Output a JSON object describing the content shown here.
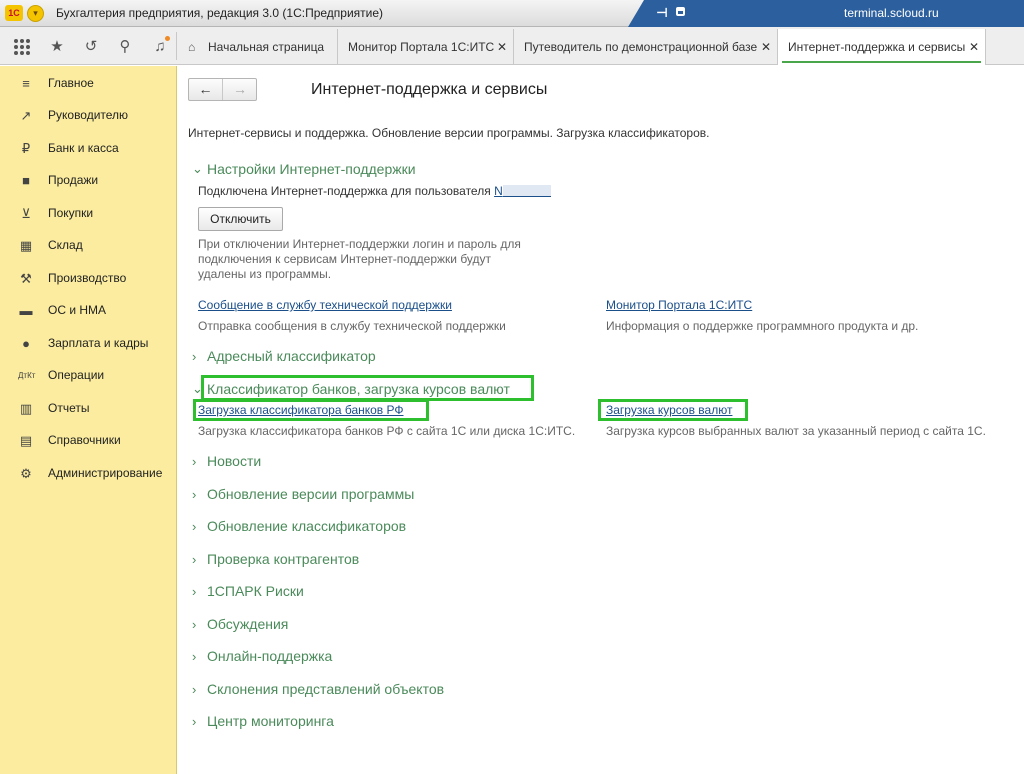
{
  "window": {
    "logo": "1С",
    "title": "Бухгалтерия предприятия, редакция 3.0 (1С:Предприятие)",
    "host": "terminal.scloud.ru"
  },
  "tabs": [
    {
      "label": "Начальная страница",
      "icon": "home-icon"
    },
    {
      "label": "Монитор Портала 1С:ИТС",
      "close": "✕"
    },
    {
      "label": "Путеводитель по демонстрационной базе",
      "close": "✕"
    },
    {
      "label": "Интернет-поддержка и сервисы",
      "close": "✕",
      "active": true
    }
  ],
  "sidebar": {
    "items": [
      {
        "label": "Главное",
        "icon": "menu-lines-icon"
      },
      {
        "label": "Руководителю",
        "icon": "trend-icon"
      },
      {
        "label": "Банк и касса",
        "icon": "ruble-icon"
      },
      {
        "label": "Продажи",
        "icon": "shopping-bag-icon"
      },
      {
        "label": "Покупки",
        "icon": "cart-icon"
      },
      {
        "label": "Склад",
        "icon": "warehouse-icon"
      },
      {
        "label": "Производство",
        "icon": "factory-icon"
      },
      {
        "label": "ОС и НМА",
        "icon": "truck-icon"
      },
      {
        "label": "Зарплата и кадры",
        "icon": "person-icon"
      },
      {
        "label": "Операции",
        "icon": "dt-kt-icon"
      },
      {
        "label": "Отчеты",
        "icon": "bar-chart-icon"
      },
      {
        "label": "Справочники",
        "icon": "books-icon"
      },
      {
        "label": "Администрирование",
        "icon": "gear-icon"
      }
    ]
  },
  "page": {
    "title": "Интернет-поддержка и сервисы",
    "intro": "Интернет-сервисы и поддержка. Обновление версии программы. Загрузка классификаторов.",
    "settings": {
      "heading": "Настройки Интернет-поддержки",
      "connected_text": "Подключена Интернет-поддержка для пользователя",
      "user_name": "N",
      "disconnect_button": "Отключить",
      "hint_line1": "При отключении Интернет-поддержки логин и пароль для",
      "hint_line2": "подключения к сервисам Интернет-поддержки будут",
      "hint_line3": "удалены из программы.",
      "link_support": "Сообщение в службу технической поддержки",
      "link_support_desc": "Отправка сообщения в службу технической поддержки",
      "link_monitor": "Монитор Портала 1С:ИТС",
      "link_monitor_desc": "Информация о поддержке программного продукта и др."
    },
    "address_classifier": "Адресный классификатор",
    "banks": {
      "heading": "Классификатор банков, загрузка курсов валют",
      "link_banks": "Загрузка классификатора банков РФ",
      "link_banks_desc": "Загрузка классификатора банков РФ с сайта 1С или диска 1С:ИТС.",
      "link_rates": "Загрузка курсов валют",
      "link_rates_desc": "Загрузка курсов выбранных валют за указанный период с сайта 1С."
    },
    "sections": [
      "Новости",
      "Обновление версии программы",
      "Обновление классификаторов",
      "Проверка контрагентов",
      "1СПАРК Риски",
      "Обсуждения",
      "Онлайн-поддержка",
      "Склонения представлений объектов",
      "Центр мониторинга"
    ]
  },
  "colors": {
    "sidebar": "#fbec9f",
    "section_heading": "#4a8a5a",
    "link": "#1b4f8a",
    "highlight": "#2dbf2d",
    "tray": "#2c5f9e"
  }
}
